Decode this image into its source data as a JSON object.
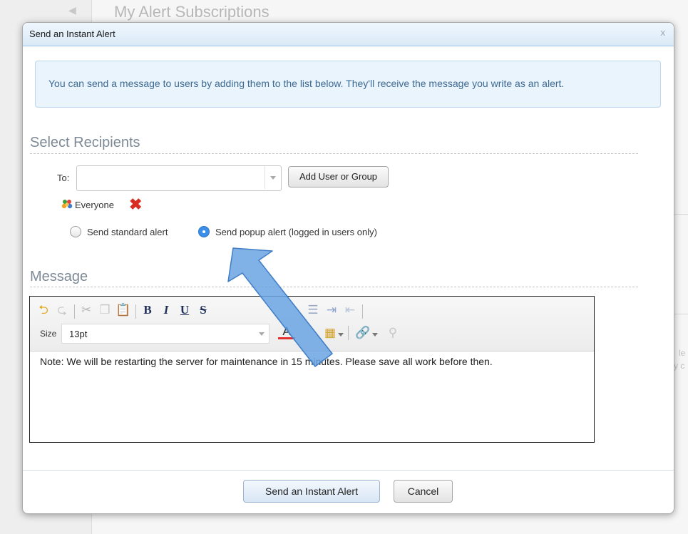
{
  "background": {
    "page_title": "My Alert Subscriptions",
    "fragments": [
      "le",
      "y c"
    ]
  },
  "dialog": {
    "title": "Send an Instant Alert",
    "close_label": "x",
    "info_text": "You can send a message to users by adding them to the list below. They'll receive the message you write as an alert."
  },
  "recipients": {
    "section_title": "Select Recipients",
    "to_label": "To:",
    "to_value": "",
    "add_button": "Add User or Group",
    "items": [
      {
        "name": "Everyone",
        "icon": "group-icon",
        "remove_icon": "red-x-icon"
      }
    ],
    "alert_types": [
      {
        "label": "Send standard alert",
        "selected": false
      },
      {
        "label": "Send popup alert (logged in users only)",
        "selected": true
      }
    ]
  },
  "message": {
    "section_title": "Message",
    "size_label": "Size",
    "size_value": "13pt",
    "toolbar_icons": [
      "undo-icon",
      "redo-icon",
      "cut-icon",
      "copy-icon",
      "paste-icon",
      "bold-icon",
      "italic-icon",
      "underline-icon",
      "strikethrough-icon",
      "ordered-list-icon",
      "indent-icon",
      "outdent-icon",
      "font-color-icon",
      "highlight-color-icon",
      "link-icon",
      "unlink-icon"
    ],
    "toolbar_glyphs": {
      "bold": "B",
      "italic": "I",
      "underline": "U",
      "strike": "S"
    },
    "body": "Note: We will be restarting the server for maintenance in 15 minutes. Please save all work before then."
  },
  "footer": {
    "send_button": "Send an Instant Alert",
    "cancel_button": "Cancel"
  },
  "colors": {
    "accent": "#3b8fe8",
    "info_bg": "#eaf4fc",
    "info_text": "#3d6a92",
    "arrow_fill": "#6aa3e3",
    "remove": "#d92b20"
  }
}
